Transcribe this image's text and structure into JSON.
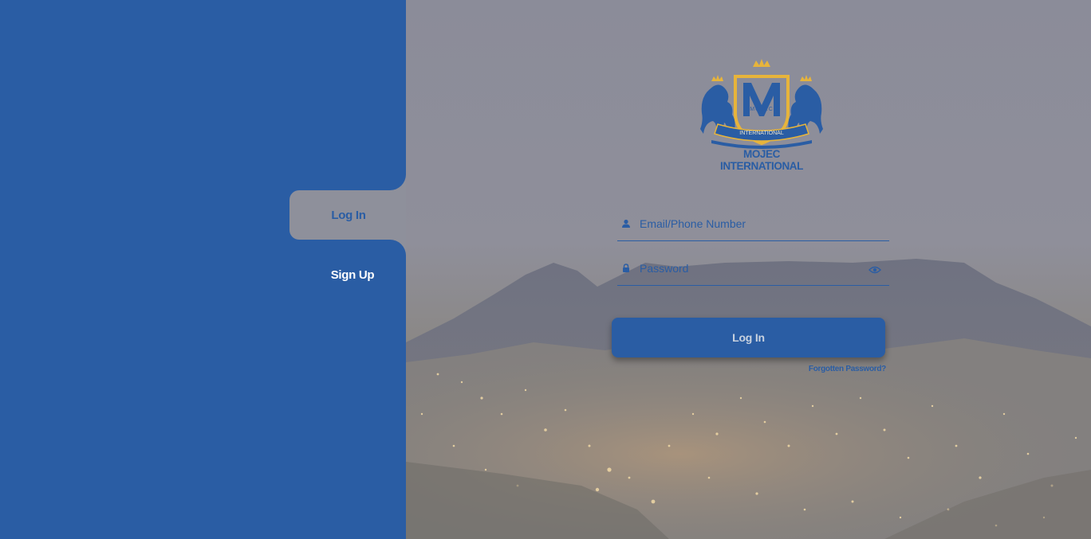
{
  "sidebar": {
    "tabs": [
      {
        "label": "Log In",
        "active": true
      },
      {
        "label": "Sign Up",
        "active": false
      }
    ]
  },
  "brand": {
    "name_line1": "MOJEC",
    "name_line2": "INTERNATIONAL",
    "logo_banner_text": "INTERNATIONAL",
    "logo_shield_text": "MOJEC",
    "colors": {
      "primary": "#2a5da4",
      "gold": "#e7b43b"
    }
  },
  "form": {
    "email": {
      "placeholder": "Email/Phone Number",
      "value": "",
      "icon": "user-icon"
    },
    "password": {
      "placeholder": "Password",
      "value": "",
      "icon": "lock-icon",
      "toggle_icon": "eye-icon"
    },
    "submit_label": "Log In",
    "forgot_label": "Forgotten Password?"
  }
}
